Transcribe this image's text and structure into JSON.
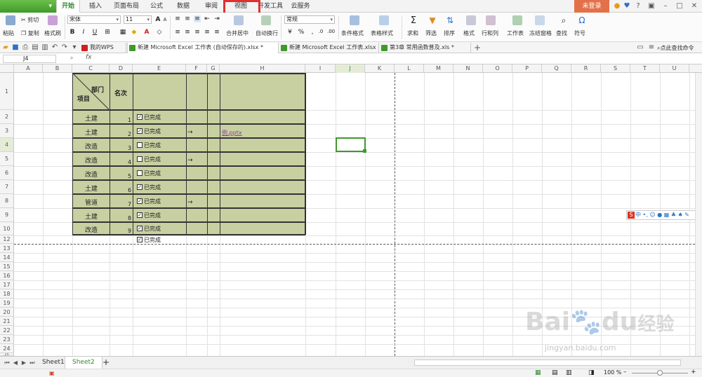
{
  "menu": {
    "tabs": [
      "开始",
      "插入",
      "页面布局",
      "公式",
      "数据",
      "审阅",
      "视图",
      "开发工具",
      "云服务"
    ],
    "active": "开始",
    "login_label": "未登录"
  },
  "ribbon": {
    "paste": "粘贴",
    "cut": "剪切",
    "copy": "复制",
    "format_painter": "格式刷",
    "font_name": "宋体",
    "font_size": "11",
    "merge_center": "合并居中",
    "wrap_text": "自动换行",
    "number_format": "常规",
    "conditional_format": "条件格式",
    "table_style": "表格样式",
    "sum": "求和",
    "filter": "筛选",
    "sort": "排序",
    "format": "格式",
    "row_col": "行和列",
    "worksheet": "工作表",
    "freeze": "冻结窗格",
    "find": "查找",
    "symbol": "符号",
    "bold": "B",
    "italic": "I",
    "underline": "U",
    "font_color_letter": "A"
  },
  "doc_tabs": [
    {
      "label": "我的WPS",
      "active": false
    },
    {
      "label": "新建 Microsoft Excel 工作表 (自动保存的).xlsx *",
      "active": true
    },
    {
      "label": "新建 Microsoft Excel 工作表.xlsx",
      "active": false
    },
    {
      "label": "第3章 常用函数普及.xls *",
      "active": false
    }
  ],
  "find_command": "点此查找命令",
  "formula_bar": {
    "cell_ref": "J4",
    "fx": "fx",
    "value": ""
  },
  "columns": [
    "A",
    "B",
    "C",
    "D",
    "E",
    "F",
    "G",
    "H",
    "I",
    "J",
    "K",
    "L",
    "M",
    "N",
    "O",
    "P",
    "Q",
    "R",
    "S",
    "T",
    "U"
  ],
  "rows": [
    "1",
    "2",
    "3",
    "4",
    "5",
    "6",
    "7",
    "8",
    "9",
    "10",
    "12",
    "13",
    "14",
    "15",
    "16",
    "17",
    "18",
    "19",
    "20",
    "21",
    "22",
    "23",
    "24",
    "25"
  ],
  "table": {
    "header_dept": "部门",
    "header_item": "项目",
    "header_rank": "名次",
    "rows": [
      {
        "item": "土建",
        "rank": "1",
        "checked": true
      },
      {
        "item": "土建",
        "rank": "2",
        "checked": true
      },
      {
        "item": "改造",
        "rank": "3",
        "checked": false
      },
      {
        "item": "改造",
        "rank": "4",
        "checked": false
      },
      {
        "item": "改造",
        "rank": "5",
        "checked": false
      },
      {
        "item": "土建",
        "rank": "6",
        "checked": true
      },
      {
        "item": "管道",
        "rank": "7",
        "checked": true
      },
      {
        "item": "土建",
        "rank": "8",
        "checked": true
      },
      {
        "item": "改造",
        "rank": "9",
        "checked": true
      }
    ],
    "checkbox_label": "已完成",
    "extra_checkbox_label": "已完成",
    "link_text": "例.pptx",
    "arrow": "→"
  },
  "sheets": [
    "Sheet1",
    "Sheet2"
  ],
  "active_sheet": "Sheet2",
  "add_sheet": "+",
  "zoom": "100 %",
  "watermark": {
    "brand": "Bai",
    "suffix": "du",
    "cn": "经验",
    "url": "jingyan.baidu.com"
  }
}
